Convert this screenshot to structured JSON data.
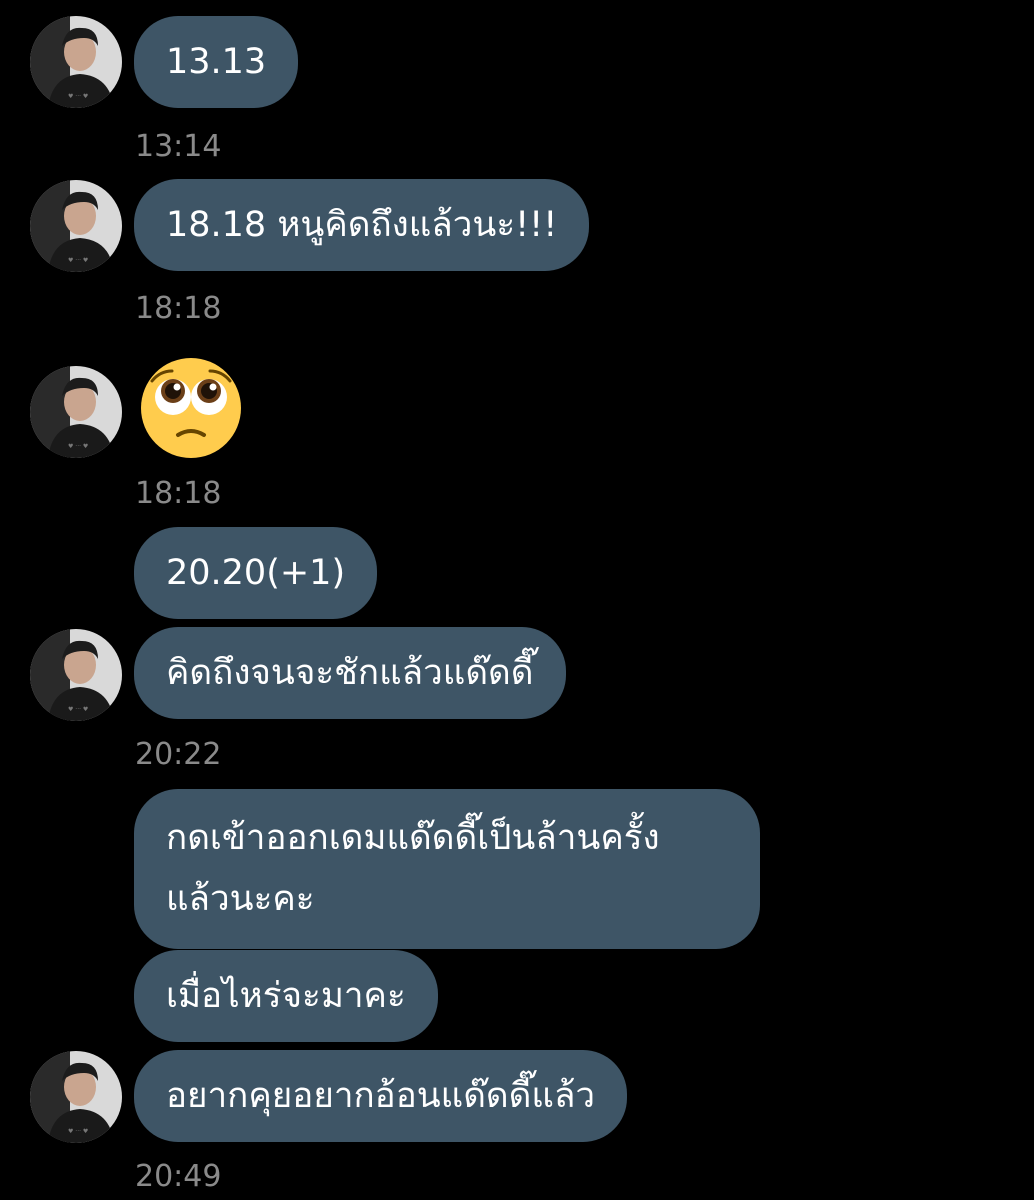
{
  "messages": [
    {
      "id": "m1",
      "text": "13.13"
    },
    {
      "id": "m2",
      "text": "18.18 หนูคิดถึงแล้วนะ!!!"
    },
    {
      "id": "m3",
      "emoji": "pleading-face"
    },
    {
      "id": "m4",
      "text": "20.20(+1)"
    },
    {
      "id": "m5",
      "text": "คิดถึงจนจะชักแล้วแด๊ดดี๊"
    },
    {
      "id": "m6",
      "line1": "กดเข้าออกเดมแด๊ดดี๊เป็นล้านครั้ง",
      "line2": "แล้วนะคะ"
    },
    {
      "id": "m7",
      "text": "เมื่อไหร่จะมาคะ"
    },
    {
      "id": "m8",
      "text": "อยากคุยอยากอ้อนแด๊ดดี๊แล้ว"
    }
  ],
  "timestamps": {
    "t1": "13:14",
    "t2": "18:18",
    "t3": "18:18",
    "t4": "20:22",
    "t5": "20:49"
  },
  "colors": {
    "background": "#000000",
    "bubble": "#3e5566",
    "text": "#ffffff",
    "timestamp": "#8a8a8a"
  },
  "icons": {
    "avatar": "user-avatar-photo",
    "emoji": "pleading-face-emoji"
  }
}
